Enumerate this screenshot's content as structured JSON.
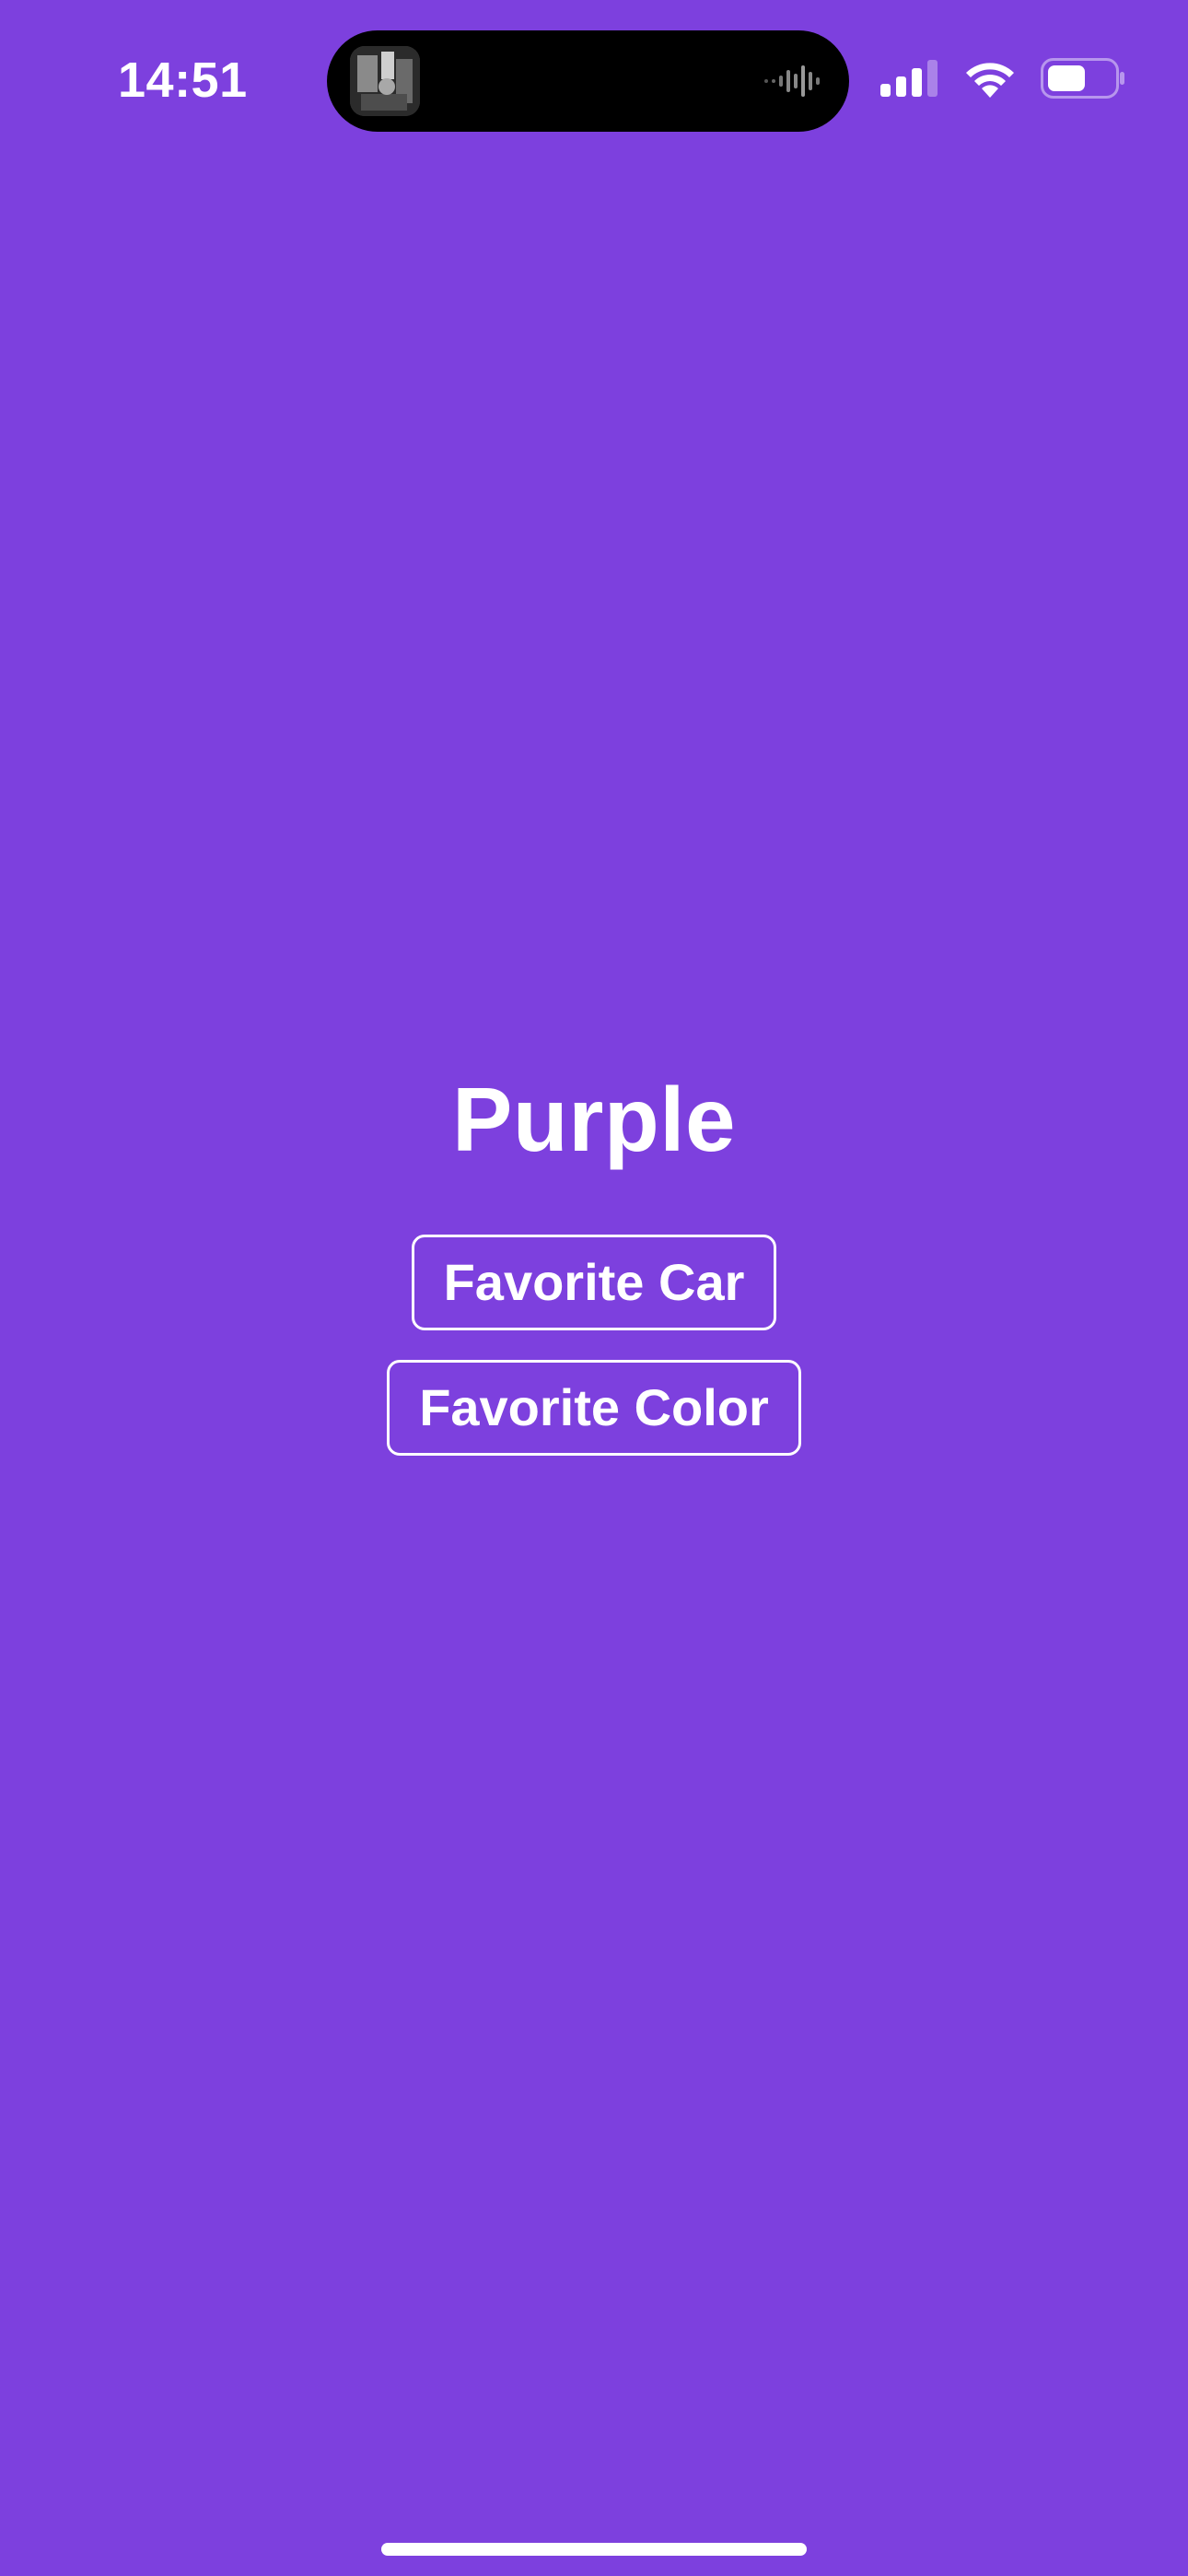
{
  "status_bar": {
    "time": "14:51",
    "signal_icon": "cellular-signal-icon",
    "wifi_icon": "wifi-icon",
    "battery_icon": "battery-icon"
  },
  "dynamic_island": {
    "thumbnail_icon": "now-playing-artwork",
    "activity_icon": "audio-waveform-icon"
  },
  "main": {
    "title": "Purple",
    "buttons": [
      {
        "label": "Favorite Car"
      },
      {
        "label": "Favorite Color"
      }
    ]
  },
  "colors": {
    "background": "#7d40de",
    "foreground": "#ffffff"
  }
}
